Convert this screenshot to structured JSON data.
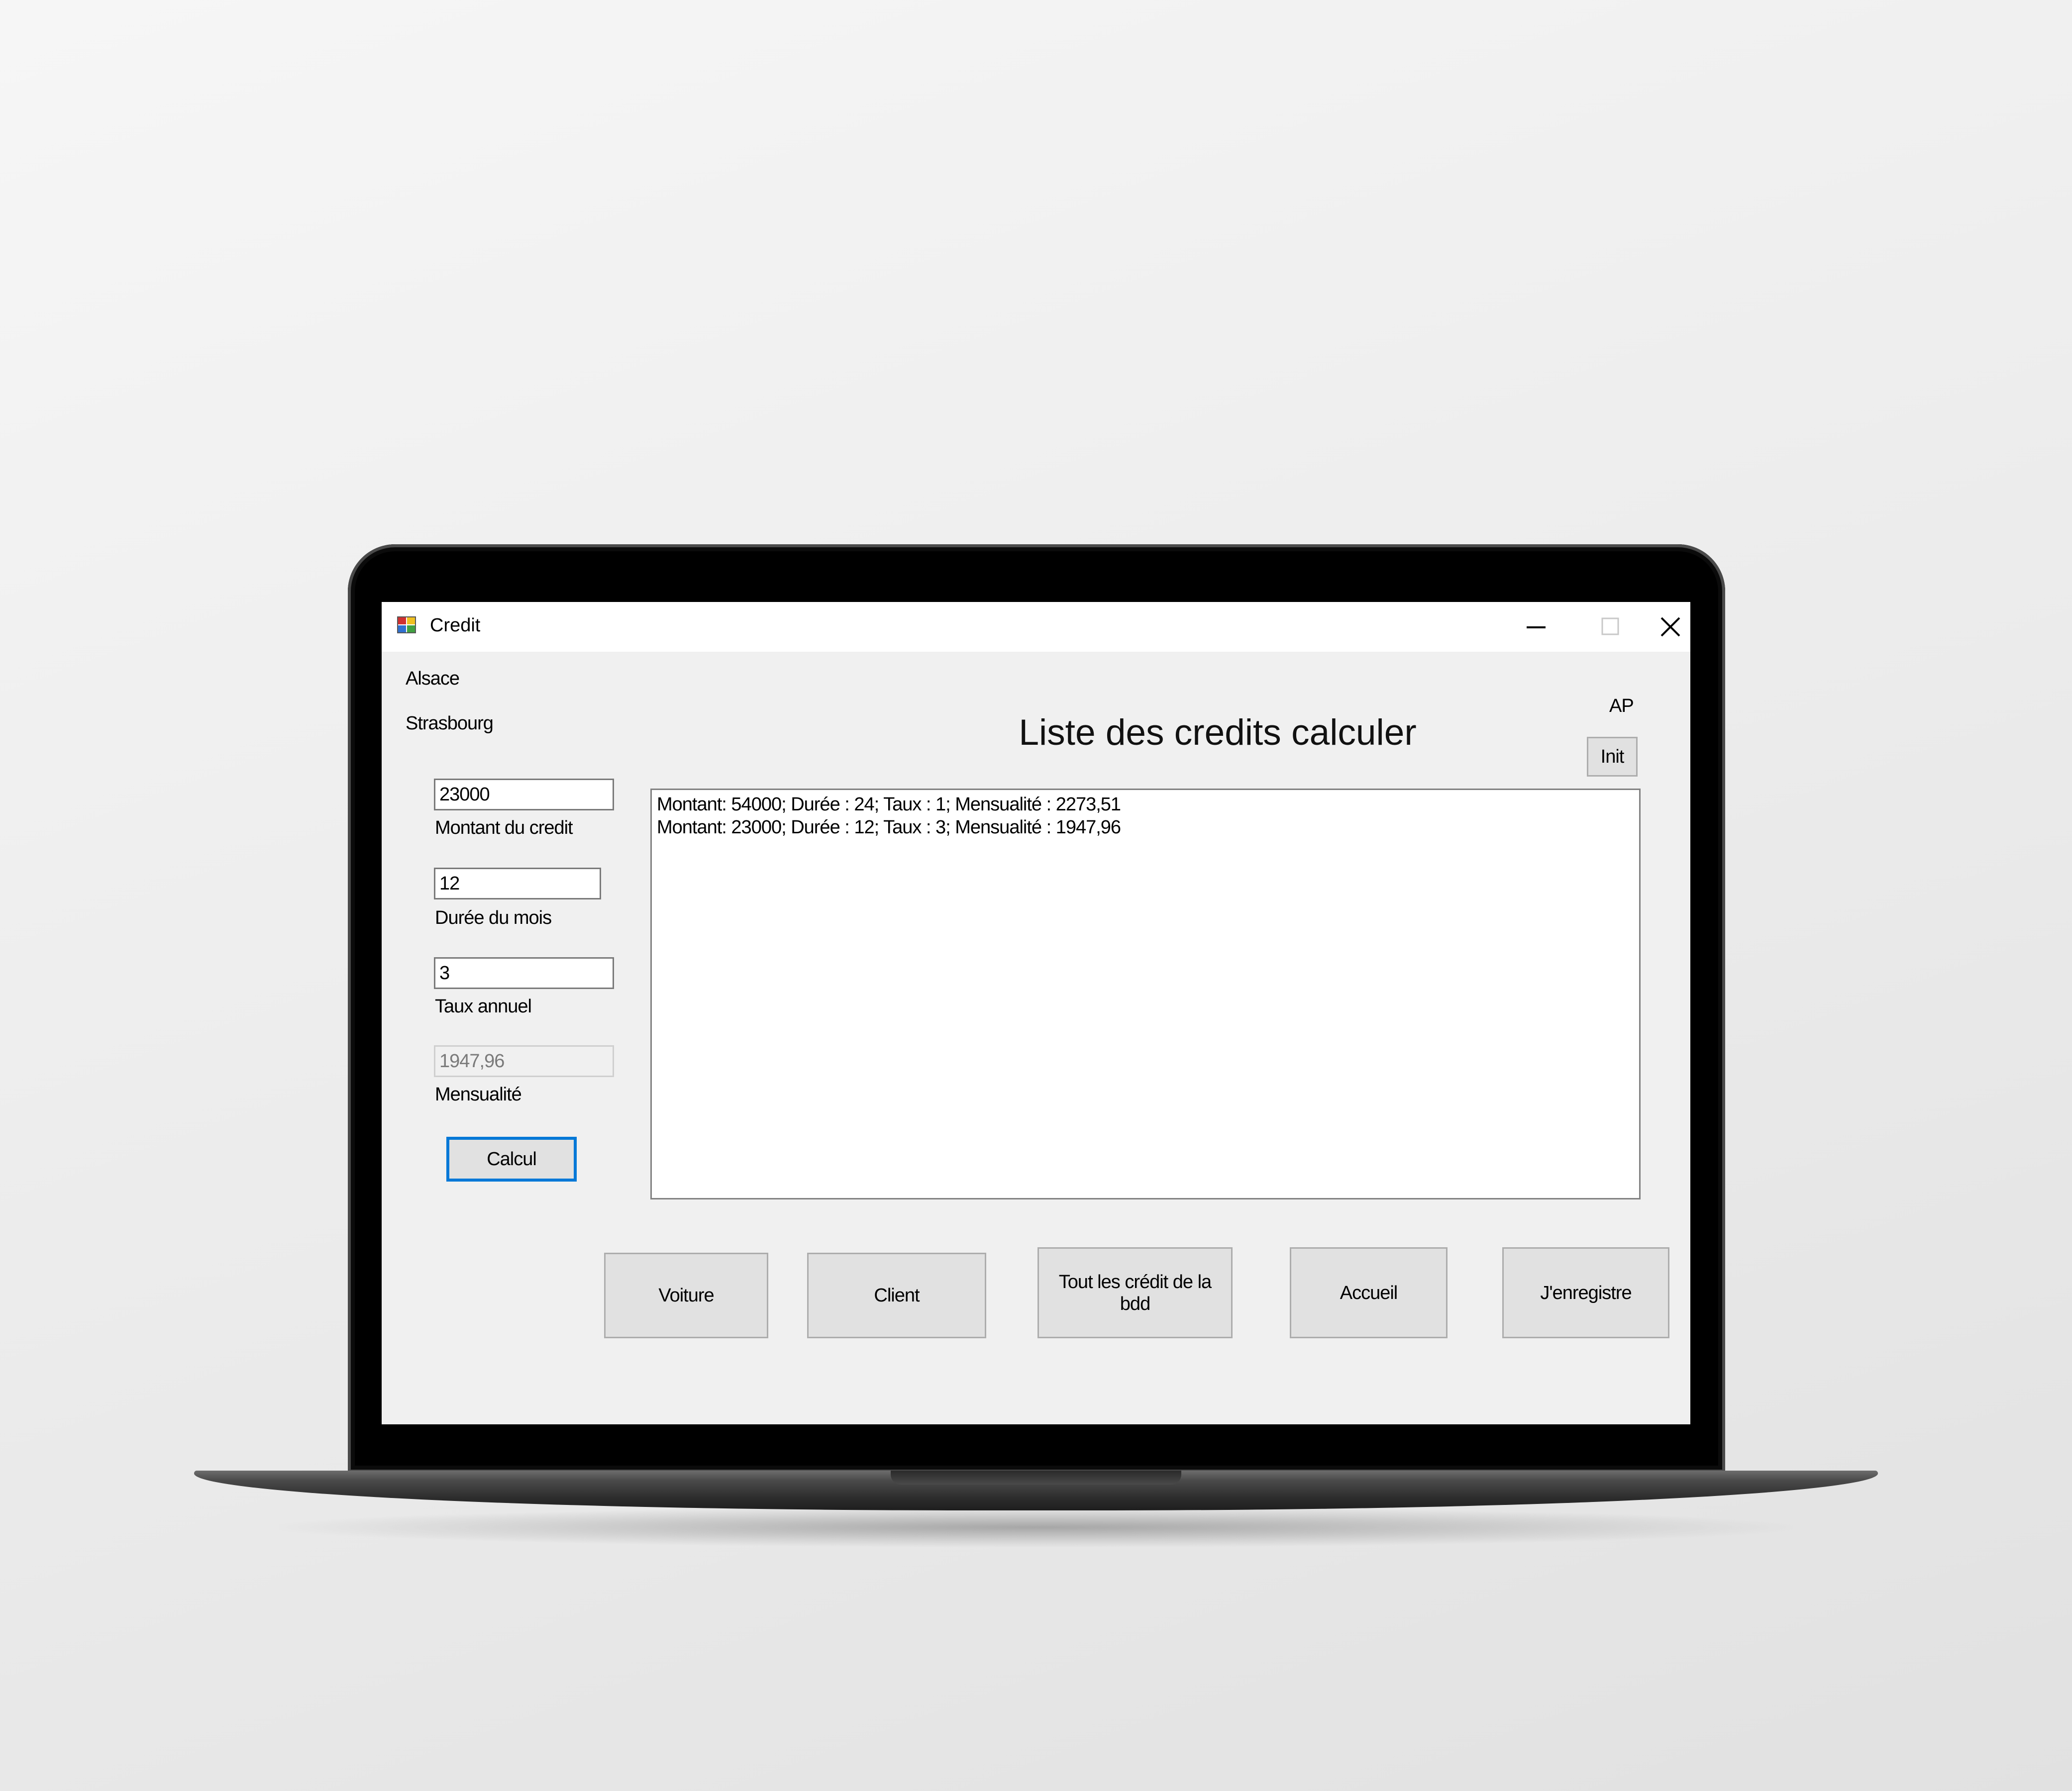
{
  "window": {
    "title": "Credit"
  },
  "labels": {
    "region": "Alsace",
    "city": "Strasbourg",
    "user_initials": "AP"
  },
  "heading": "Liste des credits calculer",
  "form": {
    "montant": {
      "value": "23000",
      "label": "Montant du credit"
    },
    "duree": {
      "value": "12",
      "label": "Durée du mois"
    },
    "taux": {
      "value": "3",
      "label": "Taux annuel"
    },
    "mensualite": {
      "value": "1947,96",
      "label": "Mensualité"
    },
    "calcul_label": "Calcul"
  },
  "init_label": "Init",
  "credit_list": [
    "Montant: 54000; Durée : 24; Taux : 1; Mensualité : 2273,51",
    "Montant: 23000; Durée : 12; Taux : 3; Mensualité : 1947,96"
  ],
  "nav_buttons": {
    "voiture": "Voiture",
    "client": "Client",
    "tout_credits": "Tout les crédit de la bdd",
    "accueil": "Accueil",
    "enregistre": "J'enregistre"
  },
  "icons": {
    "app": "app-window-icon",
    "minimize": "minimize-icon",
    "maximize": "maximize-icon",
    "close": "close-icon"
  },
  "colors": {
    "focus_accent": "#0078d7",
    "window_bg": "#f0f0f0",
    "button_bg": "#e1e1e1"
  }
}
